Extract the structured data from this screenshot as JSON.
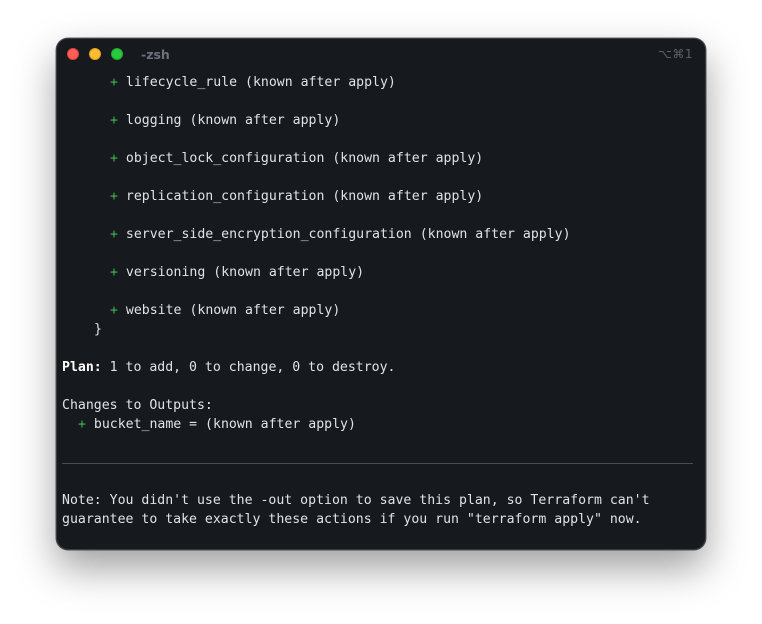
{
  "window": {
    "title": "-zsh",
    "shortcut": "⌥⌘1"
  },
  "terminal": {
    "resources": [
      {
        "name": "lifecycle_rule",
        "note": "(known after apply)"
      },
      {
        "name": "logging",
        "note": "(known after apply)"
      },
      {
        "name": "object_lock_configuration",
        "note": "(known after apply)"
      },
      {
        "name": "replication_configuration",
        "note": "(known after apply)"
      },
      {
        "name": "server_side_encryption_configuration",
        "note": "(known after apply)"
      },
      {
        "name": "versioning",
        "note": "(known after apply)"
      },
      {
        "name": "website",
        "note": "(known after apply)"
      }
    ],
    "plus_symbol": "+",
    "closing_brace": "}",
    "plan_label": "Plan:",
    "plan_summary": "1 to add, 0 to change, 0 to destroy.",
    "outputs_heading": "Changes to Outputs:",
    "output_line": "bucket_name = (known after apply)",
    "note_line1": "Note: You didn't use the -out option to save this plan, so Terraform can't",
    "note_line2": "guarantee to take exactly these actions if you run \"terraform apply\" now."
  },
  "colors": {
    "background": "#16191d",
    "text": "#dfe3e8",
    "plus": "#3fbc4e",
    "close": "#ff5f57",
    "minimize": "#febc2e",
    "maximize": "#28c840"
  }
}
